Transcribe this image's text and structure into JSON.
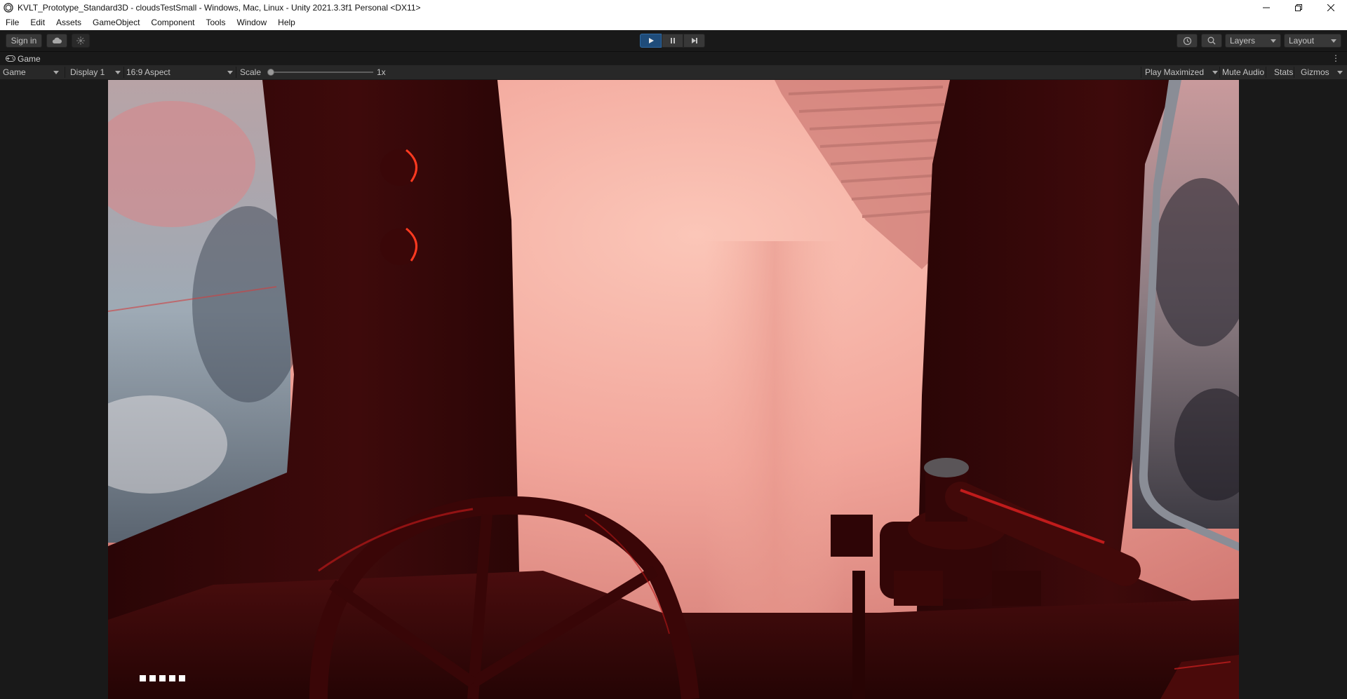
{
  "window": {
    "title": "KVLT_Prototype_Standard3D - cloudsTestSmall - Windows, Mac, Linux - Unity 2021.3.3f1 Personal <DX11>",
    "minimize_icon": "minimize-icon",
    "restore_icon": "restore-icon",
    "close_icon": "close-icon"
  },
  "menu": {
    "items": [
      "File",
      "Edit",
      "Assets",
      "GameObject",
      "Component",
      "Tools",
      "Window",
      "Help"
    ]
  },
  "toolbar": {
    "sign_in": "Sign in",
    "cloud_icon": "cloud-icon",
    "collab_icon": "collab-icon",
    "play_state": "playing",
    "layers": "Layers",
    "layout": "Layout",
    "history_icon": "history-icon",
    "search_icon": "search-icon"
  },
  "tab": {
    "label": "Game",
    "icon": "gamepad-icon"
  },
  "gamebar": {
    "view": "Game",
    "display": "Display 1",
    "aspect": "16:9 Aspect",
    "scale_label": "Scale",
    "scale_value": "1x",
    "scale_fraction": 0.0,
    "play_mode": "Play Maximized",
    "mute": "Mute Audio",
    "stats": "Stats",
    "gizmos": "Gizmos"
  },
  "scene": {
    "description_icon": "game-render-view",
    "fog_color": "#f4a89d",
    "frame_color": "#3a0a0a",
    "accent_red": "#d01818",
    "overlay_dot_count": 5
  }
}
